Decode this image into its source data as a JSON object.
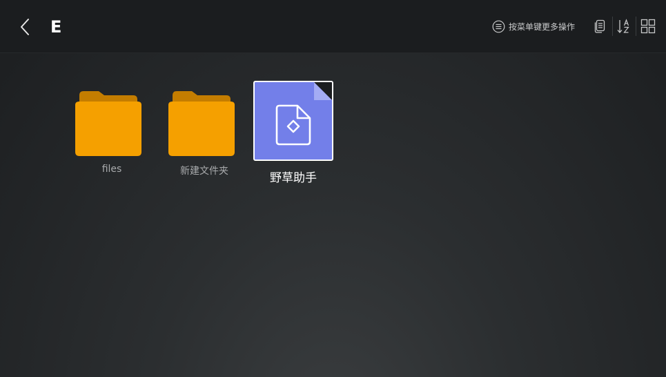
{
  "header": {
    "title": "E",
    "menu_hint": "按菜单键更多操作",
    "icons": [
      "back-chevron-icon",
      "menu-hint-icon",
      "copy-icon",
      "sort-az-icon",
      "grid-view-icon"
    ]
  },
  "items": [
    {
      "type": "folder",
      "label": "files",
      "icon": "folder-icon"
    },
    {
      "type": "folder",
      "label": "新建文件夹",
      "icon": "folder-icon"
    },
    {
      "type": "file",
      "label": "野草助手",
      "icon": "file-diamond-icon",
      "selected": true
    }
  ],
  "colors": {
    "background": "#2b2e30",
    "header": "#1b1d1f",
    "folder": "#f5a000",
    "folder_tab": "#c47d00",
    "file_tile": "#737fe9",
    "label_text": "#a9abad"
  }
}
